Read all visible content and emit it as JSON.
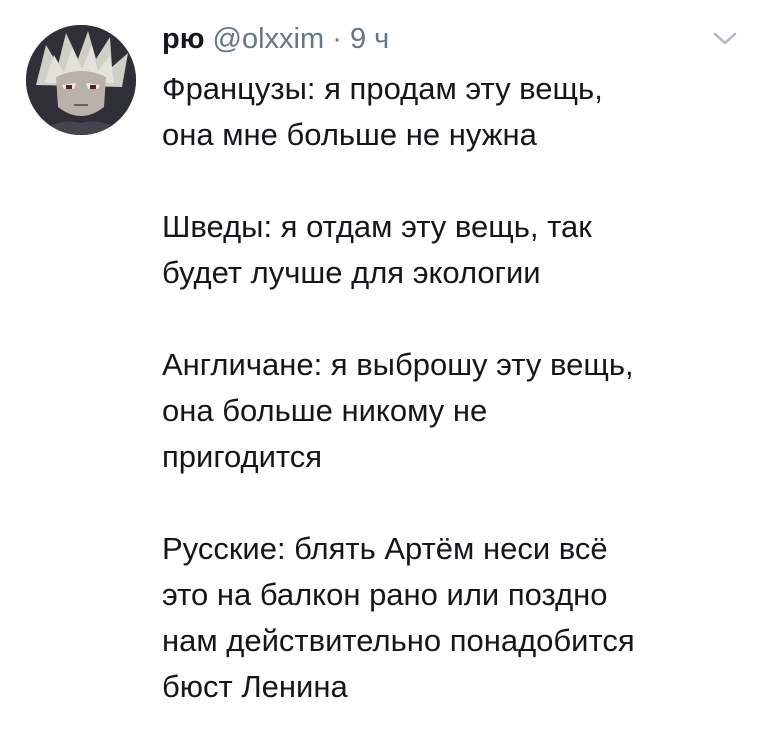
{
  "tweet": {
    "author": {
      "name": "рю",
      "handle": "@olxxim",
      "separator": "·",
      "time": "9 ч"
    },
    "icons": {
      "avatar": "profile-avatar",
      "menu": "chevron-down-icon"
    },
    "paragraphs": [
      {
        "lines": [
          "Французы: я продам эту вещь,",
          "она мне больше не нужна"
        ]
      },
      {
        "lines": [
          "Шведы: я отдам эту вещь, так",
          "будет лучше для экологии"
        ]
      },
      {
        "lines": [
          "Англичане: я выброшу эту вещь,",
          "она больше никому не",
          "пригодится"
        ]
      },
      {
        "lines": [
          "Русские: блять Артём неси всё",
          "это на балкон рано или поздно",
          "нам действительно понадобится",
          "бюст Ленина"
        ]
      }
    ],
    "colors": {
      "text": "#14171a",
      "secondary": "#657786",
      "background": "#ffffff"
    }
  }
}
